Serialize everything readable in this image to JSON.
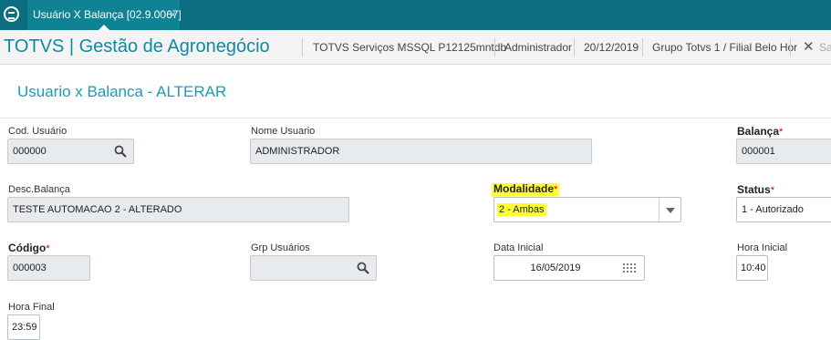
{
  "tabbar": {
    "tab_label": "Usuário X Balança [02.9.0067]",
    "tab_close": "×"
  },
  "header": {
    "brand": "TOTVS | Gestão de Agronegócio",
    "environment": "TOTVS Serviços MSSQL P12125mntdb",
    "user": "Administrador",
    "date": "20/12/2019",
    "company": "Grupo Totvs 1 / Filial Belo Hor",
    "close_label": "Sa"
  },
  "page": {
    "title": "Usuario x Balanca - ALTERAR"
  },
  "form": {
    "cod_usuario": {
      "label": "Cod. Usuário",
      "value": "000000"
    },
    "nome_usuario": {
      "label": "Nome Usuario",
      "value": "ADMINISTRADOR"
    },
    "balanca": {
      "label": "Balança",
      "value": "000001"
    },
    "desc_balanca": {
      "label": "Desc.Balança",
      "value": "TESTE AUTOMACAO 2  - ALTERADO"
    },
    "modalidade": {
      "label": "Modalidade",
      "value": "2 - Ambas"
    },
    "status": {
      "label": "Status",
      "value": "1 - Autorizado"
    },
    "codigo": {
      "label": "Código",
      "value": "000003"
    },
    "grp_usuarios": {
      "label": "Grp Usuários",
      "value": ""
    },
    "data_inicial": {
      "label": "Data Inicial",
      "value": "16/05/2019"
    },
    "hora_inicial": {
      "label": "Hora Inicial",
      "value": "10:40"
    },
    "hora_final": {
      "label": "Hora Final",
      "value": "23:59"
    },
    "required_mark": "*"
  },
  "colors": {
    "tabbar": "#0b6e7e",
    "brand": "#0f8aa3",
    "title": "#1f9bb3",
    "highlight": "#ffff33",
    "required": "#cc0000"
  }
}
